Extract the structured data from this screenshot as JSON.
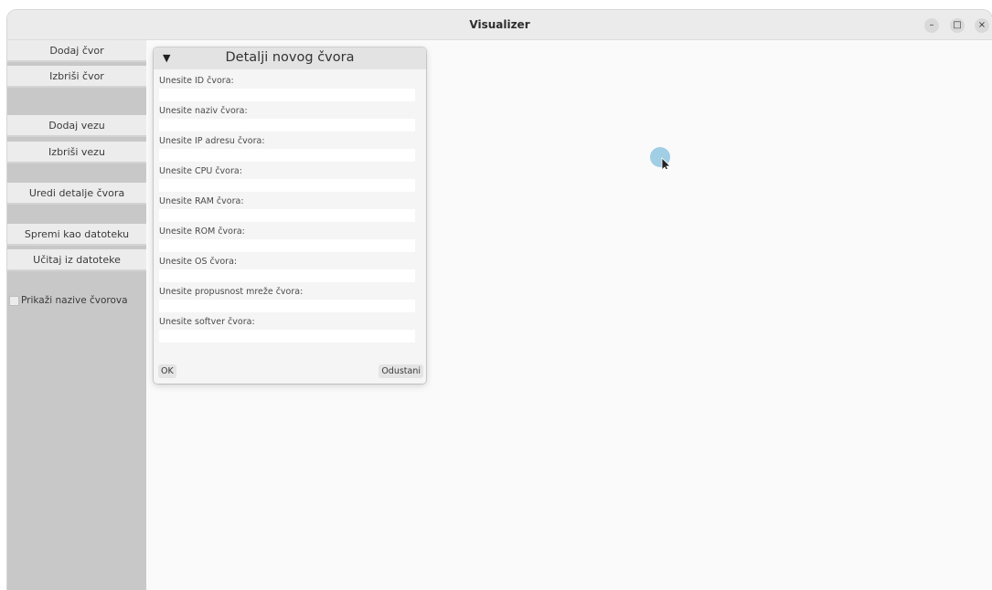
{
  "window": {
    "title": "Visualizer",
    "controls": {
      "minimize_icon": "minimize-icon",
      "maximize_icon": "maximize-icon",
      "close_icon": "close-icon",
      "minimize_glyph": "–",
      "maximize_glyph": "□",
      "close_glyph": "×"
    }
  },
  "sidebar": {
    "add_node": "Dodaj čvor",
    "delete_node": "Izbriši čvor",
    "add_link": "Dodaj vezu",
    "delete_link": "Izbriši vezu",
    "edit_node_details": "Uredi detalje čvora",
    "save_to_file": "Spremi kao datoteku",
    "load_from_file": "Učitaj iz datoteke",
    "show_node_names": {
      "label": "Prikaži nazive čvorova",
      "checked": false
    }
  },
  "dialog": {
    "collapse_glyph": "▼",
    "title": "Detalji novog čvora",
    "fields": [
      {
        "label": "Unesite ID čvora:",
        "value": ""
      },
      {
        "label": "Unesite naziv čvora:",
        "value": ""
      },
      {
        "label": "Unesite IP adresu čvora:",
        "value": ""
      },
      {
        "label": "Unesite CPU čvora:",
        "value": ""
      },
      {
        "label": "Unesite RAM čvora:",
        "value": ""
      },
      {
        "label": "Unesite ROM čvora:",
        "value": ""
      },
      {
        "label": "Unesite OS čvora:",
        "value": ""
      },
      {
        "label": "Unesite propusnost mreže čvora:",
        "value": ""
      },
      {
        "label": "Unesite softver čvora:",
        "value": ""
      }
    ],
    "ok_label": "OK",
    "cancel_label": "Odustani"
  },
  "colors": {
    "sidebar_bg": "#c8c8c8",
    "sidebar_button": "#ececec",
    "canvas_bg": "#fafafa",
    "cursor_highlight": "#8ec5e0"
  }
}
